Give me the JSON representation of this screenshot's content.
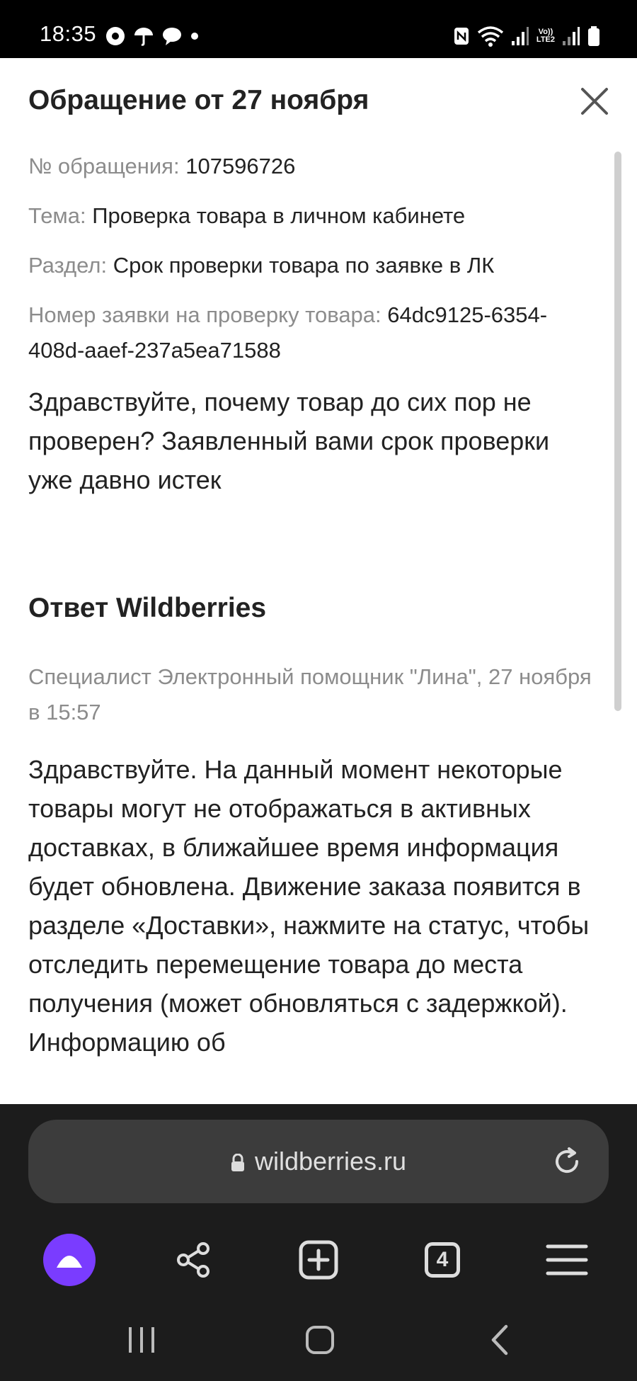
{
  "status_bar": {
    "time": "18:35",
    "network_label": "Vo))\nLTE2"
  },
  "sheet": {
    "title": "Обращение от 27 ноября",
    "fields": [
      {
        "label": "№ обращения:",
        "value": "107596726"
      },
      {
        "label": "Тема:",
        "value": "Проверка товара в личном кабинете"
      },
      {
        "label": "Раздел:",
        "value": "Срок проверки товара по заявке в ЛК"
      },
      {
        "label": "Номер заявки на проверку товара:",
        "value": "64dc9125-6354-408d-aaef-237a5ea71588"
      }
    ],
    "question": "Здравствуйте, почему товар до сих пор не проверен? Заявленный вами срок проверки уже давно истек",
    "answer_title": "Ответ Wildberries",
    "answer_author": "Специалист Электронный помощник \"Лина\", 27 ноября в 15:57",
    "answer_text": "Здравствуйте. На данный момент некоторые товары могут не отображаться в активных доставках, в ближайшее время информация будет обновлена. Движение заказа появится в разделе «Доставки», нажмите на статус, чтобы отследить перемещение товара до места получения (может обновляться с задержкой). Информацию об"
  },
  "browser": {
    "url": "wildberries.ru",
    "tab_count": "4"
  },
  "colors": {
    "accent_alice": "#7a3cff",
    "label_gray": "#8c8c8c",
    "text": "#222222",
    "browser_bg": "#1c1c1c",
    "url_bar_bg": "#3c3c3c"
  },
  "icons": {
    "status_left": [
      "chrome-icon",
      "umbrella-icon",
      "chat-icon",
      "dot-icon"
    ],
    "status_right": [
      "nfc-icon",
      "wifi-icon",
      "signal-icon",
      "lte-icon",
      "signal-icon",
      "battery-icon"
    ],
    "toolbar": [
      "alice-icon",
      "share-icon",
      "new-tab-icon",
      "tabs-icon",
      "menu-icon"
    ],
    "navbar": [
      "recents-icon",
      "home-icon",
      "back-icon"
    ]
  }
}
